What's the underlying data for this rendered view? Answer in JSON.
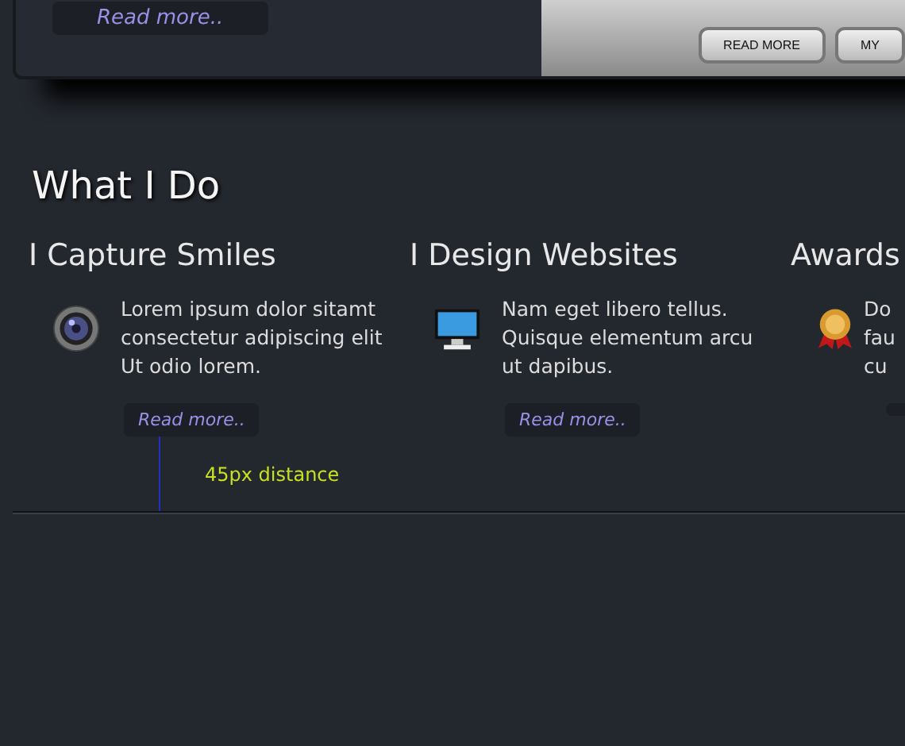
{
  "top_panel": {
    "read_more": "Read more..",
    "banner_buttons": [
      "READ MORE",
      "MY"
    ]
  },
  "section": {
    "title": "What I Do"
  },
  "columns": [
    {
      "title": "I Capture Smiles",
      "kind": "camera",
      "text": "Lorem ipsum dolor sitamt\nconsectetur adipiscing elit\nUt odio lorem.",
      "link": "Read more.."
    },
    {
      "title": "I Design Websites",
      "kind": "monitor",
      "text": "Nam eget libero tellus.\nQuisque elementum arcu\nut dapibus.",
      "link": "Read more.."
    },
    {
      "title": "Awards",
      "kind": "medal",
      "text": "Do\nfau\ncu"
    }
  ],
  "annotation": {
    "label": "45px distance"
  }
}
